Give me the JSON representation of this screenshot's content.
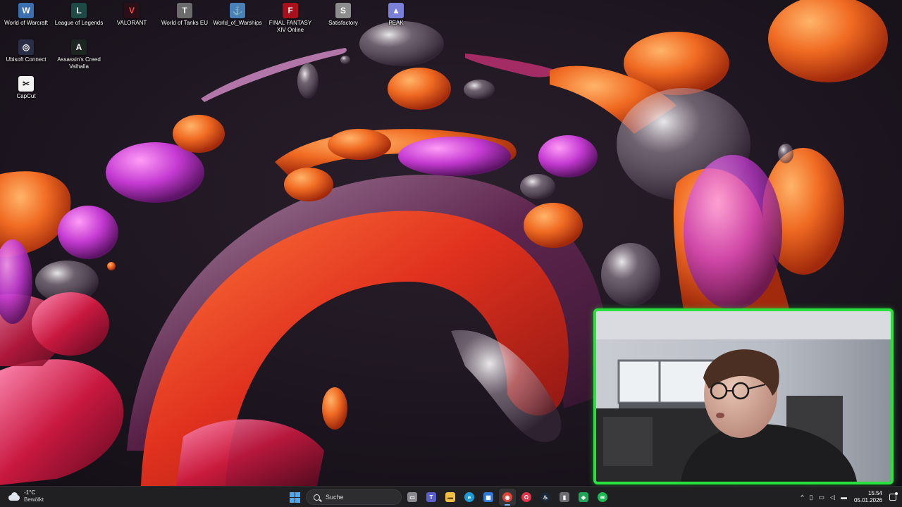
{
  "desktop": {
    "icons": [
      {
        "label": "World of Warcraft",
        "icon": "world-of-warcraft-icon",
        "color": "#3a6fb0",
        "glyph": "W"
      },
      {
        "label": "League of Legends",
        "icon": "league-of-legends-icon",
        "color": "#1d4a44",
        "glyph": "L"
      },
      {
        "label": "VALORANT",
        "icon": "valorant-icon",
        "color": "#2a1016",
        "glyph": "V"
      },
      {
        "label": "World of Tanks EU",
        "icon": "world-of-tanks-icon",
        "color": "#6b6b6b",
        "glyph": "T"
      },
      {
        "label": "World_of_Warships",
        "icon": "world-of-warships-icon",
        "color": "#4a80b8",
        "glyph": "⚓"
      },
      {
        "label": "FINAL FANTASY XIV Online",
        "icon": "final-fantasy-xiv-icon",
        "color": "#a8111b",
        "glyph": "F"
      },
      {
        "label": "Satisfactory",
        "icon": "satisfactory-icon",
        "color": "#8d8d8d",
        "glyph": "S"
      },
      {
        "label": "PEAK",
        "icon": "peak-icon",
        "color": "#7a7fd8",
        "glyph": "▲"
      },
      {
        "label": "Ubisoft Connect",
        "icon": "ubisoft-connect-icon",
        "color": "#2a2f48",
        "glyph": "◎"
      },
      {
        "label": "Assassin's Creed Valhalla",
        "icon": "assassins-creed-valhalla-icon",
        "color": "#1c2620",
        "glyph": "A"
      },
      {
        "label": "CapCut",
        "icon": "capcut-icon",
        "color": "#f2f2f2",
        "glyph": "✂"
      }
    ]
  },
  "taskbar": {
    "weather": {
      "temp": "-1°C",
      "condition": "Bewölkt",
      "icon": "cloud-icon"
    },
    "search_placeholder": "Suche",
    "apps": [
      {
        "icon": "task-view-icon",
        "color": "#8a8a90",
        "glyph": "▭"
      },
      {
        "icon": "teams-icon",
        "color": "#5b5fc7",
        "glyph": "T"
      },
      {
        "icon": "file-explorer-icon",
        "color": "#f1c043",
        "glyph": "▬"
      },
      {
        "icon": "edge-icon",
        "color": "#1d9bd7",
        "glyph": "e"
      },
      {
        "icon": "microsoft-store-icon",
        "color": "#2f78d6",
        "glyph": "▦"
      },
      {
        "icon": "chrome-icon",
        "color": "#db4437",
        "glyph": "◉"
      },
      {
        "icon": "opera-gx-icon",
        "color": "#e0344a",
        "glyph": "O"
      },
      {
        "icon": "steam-icon",
        "color": "#1b2838",
        "glyph": "♨"
      },
      {
        "icon": "app-icon",
        "color": "#6d6d72",
        "glyph": "▮"
      },
      {
        "icon": "discord-icon",
        "color": "#23a559",
        "glyph": "◈"
      },
      {
        "icon": "spotify-icon",
        "color": "#1db954",
        "glyph": "≋"
      }
    ],
    "active_app": "chrome-icon",
    "tray": {
      "chevron": "^",
      "time": "15:54",
      "date": "05.01.2026"
    }
  },
  "webcam": {
    "border_color": "#27e23c"
  }
}
